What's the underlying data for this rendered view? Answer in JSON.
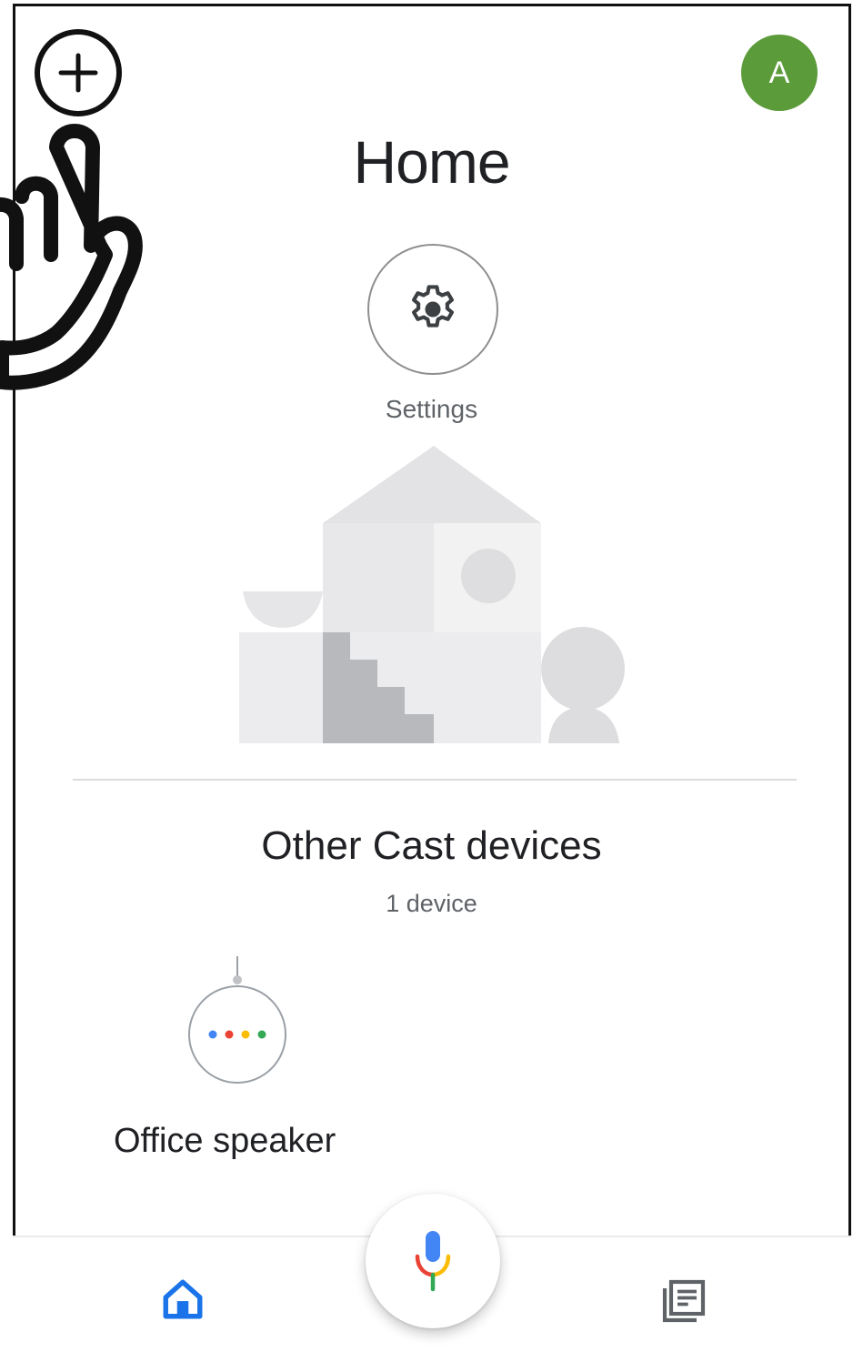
{
  "header": {
    "title": "Home",
    "add_icon": "plus-icon",
    "avatar_letter": "A",
    "avatar_color": "#5b9b3a"
  },
  "settings": {
    "label": "Settings",
    "icon": "gear-icon"
  },
  "section": {
    "title": "Other Cast devices",
    "count": "1 device"
  },
  "devices": [
    {
      "name": "Office speaker",
      "icon": "google-home-mini-icon",
      "dot_colors": [
        "#4285f4",
        "#ea4335",
        "#fbbc05",
        "#34a853"
      ]
    }
  ],
  "bottom_nav": {
    "items": [
      {
        "icon": "home-icon",
        "active": true
      },
      {
        "icon": "feed-icon",
        "active": false
      }
    ],
    "fab_icon": "microphone-icon"
  },
  "colors": {
    "accent": "#1a73e8",
    "text_primary": "#202124",
    "text_secondary": "#5f6368"
  },
  "overlay": {
    "icon": "pointing-hand-icon"
  }
}
